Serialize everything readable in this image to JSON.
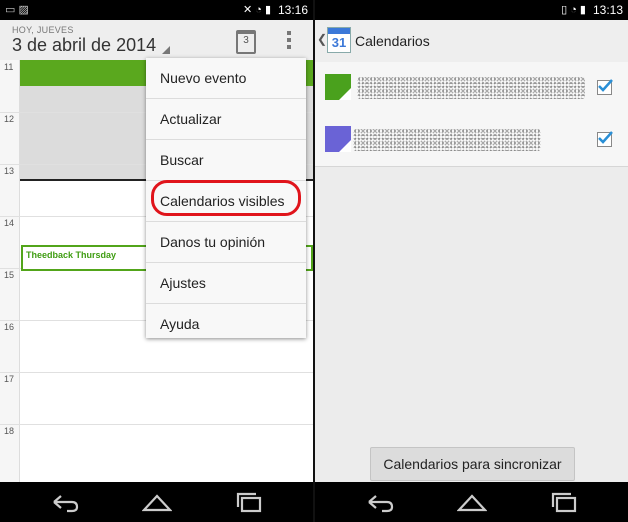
{
  "left": {
    "status": {
      "time": "13:16"
    },
    "header": {
      "day_label": "HOY, JUEVES",
      "date": "3 de abril de 2014",
      "today_number": "3"
    },
    "hours": [
      "11",
      "12",
      "13",
      "14",
      "15",
      "16",
      "17",
      "18"
    ],
    "event": {
      "title": "Theedback Thursday"
    },
    "menu": {
      "items": [
        {
          "label": "Nuevo evento"
        },
        {
          "label": "Actualizar"
        },
        {
          "label": "Buscar"
        },
        {
          "label": "Calendarios visibles"
        },
        {
          "label": "Danos tu opinión"
        },
        {
          "label": "Ajustes"
        },
        {
          "label": "Ayuda"
        }
      ]
    },
    "colors": {
      "event_green": "#52a51a",
      "highlight_red": "#e0141b"
    }
  },
  "right": {
    "status": {
      "time": "13:13"
    },
    "actionbar": {
      "title": "Calendarios",
      "icon_number": "31"
    },
    "calendars": [
      {
        "color": "#4aa11d",
        "checked": true
      },
      {
        "color": "#6a63d6",
        "checked": true
      }
    ],
    "sync_button": "Calendarios para sincronizar"
  }
}
